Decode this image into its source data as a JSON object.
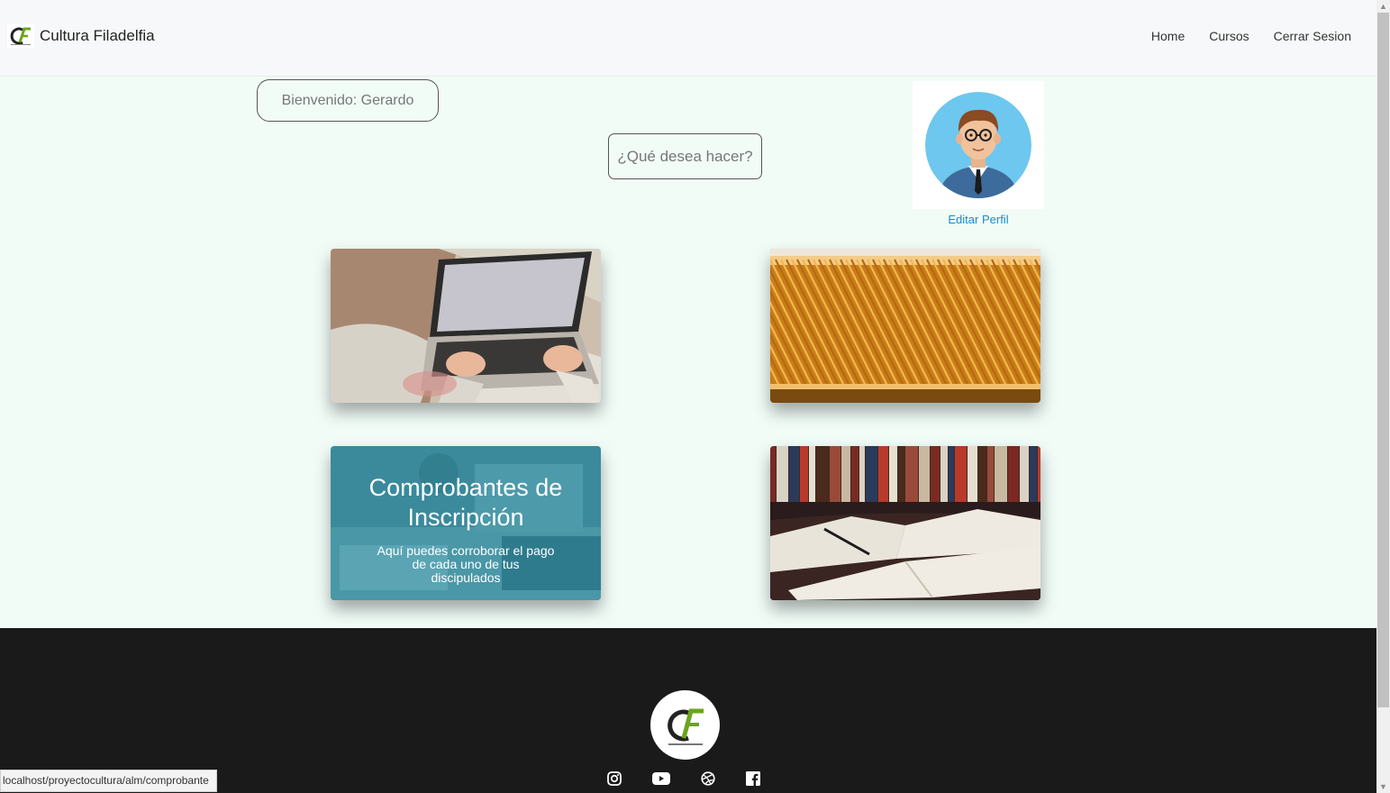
{
  "navbar": {
    "brand": "Cultura Filadelfia",
    "links": [
      "Home",
      "Cursos",
      "Cerrar Sesion"
    ]
  },
  "welcome": "Bienvenido: Gerardo",
  "question": "¿Qué desea hacer?",
  "profile": {
    "edit_label": "Editar Perfil"
  },
  "cards": [
    {
      "title": "",
      "description": "",
      "image": "laptop-typing"
    },
    {
      "title": "",
      "description": "",
      "image": "folders-files"
    },
    {
      "title": "Comprobantes de Inscripción",
      "description": "Aquí puedes corroborar el pago de cada uno de tus discipulados",
      "image": "office-desk"
    },
    {
      "title": "",
      "description": "",
      "image": "open-books"
    }
  ],
  "footer": {
    "social": [
      "instagram-icon",
      "youtube-icon",
      "dribbble-icon",
      "facebook-icon"
    ]
  },
  "status_bar": {
    "url": "localhost/proyectocultura/alm/comprobante"
  },
  "colors": {
    "accent": "#1e88c8",
    "footer": "#1a1a1a",
    "page_bg": "#f1fcf7",
    "logo_green": "#6aa51c"
  }
}
